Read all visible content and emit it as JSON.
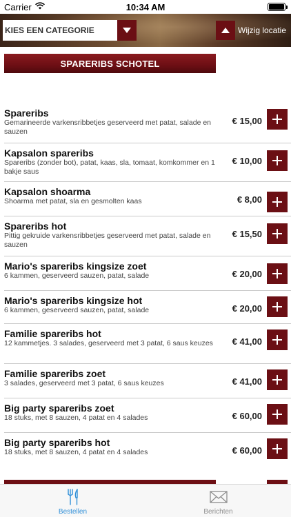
{
  "status_bar": {
    "carrier": "Carrier",
    "time": "10:34 AM"
  },
  "header": {
    "category_placeholder": "KIES EEN CATEGORIE",
    "location_label": "Wijzig locatie"
  },
  "section": {
    "title": "SPARERIBS SCHOTEL"
  },
  "colors": {
    "accent": "#6b0f14",
    "tab_active": "#2f8fd8",
    "tab_inactive": "#8e8e8e"
  },
  "menu_items": [
    {
      "name": "Spareribs",
      "description": "Gemarineerde varkensribbetjes geserveerd met patat, salade en sauzen",
      "price": "€ 15,00"
    },
    {
      "name": "Kapsalon spareribs",
      "description": "Spareribs (zonder bot), patat, kaas, sla, tomaat, komkommer en 1 bakje saus",
      "price": "€ 10,00"
    },
    {
      "name": "Kapsalon shoarma",
      "description": "Shoarma met patat, sla en gesmolten kaas",
      "price": "€ 8,00"
    },
    {
      "name": "Spareribs hot",
      "description": "Pittig gekruide varkensribbetjes geserveerd met patat, salade en sauzen",
      "price": "€ 15,50"
    },
    {
      "name": "Mario's spareribs kingsize zoet",
      "description": "6 kammen, geserveerd sauzen, patat, salade",
      "price": "€ 20,00"
    },
    {
      "name": "Mario's spareribs kingsize hot",
      "description": "6 kammen, geserveerd sauzen, patat, salade",
      "price": "€ 20,00"
    },
    {
      "name": "Familie spareribs hot",
      "description": "12 kammetjes. 3 salades, geserveerd met 3 patat, 6 saus keuzes",
      "price": "€ 41,00"
    },
    {
      "name": "Familie spareribs zoet",
      "description": "3 salades, geserveerd met 3 patat, 6 saus keuzes",
      "price": "€ 41,00"
    },
    {
      "name": "Big party spareribs zoet",
      "description": "18 stuks, met 8 sauzen, 4 patat en 4 salades",
      "price": "€ 60,00"
    },
    {
      "name": "Big party spareribs hot",
      "description": "18 stuks, met 8 sauzen, 4 patat en 4 salades",
      "price": "€ 60,00"
    }
  ],
  "tabs": [
    {
      "label": "Bestellen",
      "icon": "cutlery-icon",
      "active": true
    },
    {
      "label": "Berichten",
      "icon": "envelope-icon",
      "active": false
    }
  ]
}
